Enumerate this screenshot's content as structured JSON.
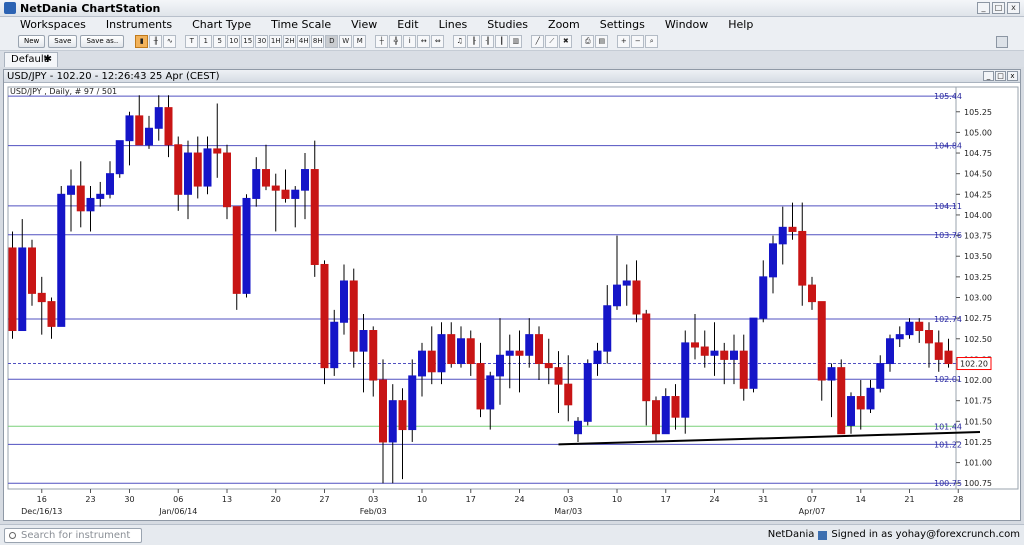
{
  "app": {
    "title": "NetDania ChartStation"
  },
  "window_buttons": [
    "_",
    "□",
    "x"
  ],
  "menu": [
    "Workspaces",
    "Instruments",
    "Chart Type",
    "Time Scale",
    "View",
    "Edit",
    "Lines",
    "Studies",
    "Zoom",
    "Settings",
    "Window",
    "Help"
  ],
  "toolbar": {
    "new_label": "New",
    "save_label": "Save",
    "saveas_label": "Save as..",
    "intervals": [
      "T",
      "1",
      "5",
      "10",
      "15",
      "30",
      "1H",
      "2H",
      "4H",
      "8H",
      "D",
      "W",
      "M"
    ],
    "selected_interval": "D"
  },
  "tab": {
    "label": "Default",
    "close": "✱"
  },
  "chart": {
    "title": "USD/JPY - 102.20 - 12:26:43  25 Apr (CEST)",
    "subtitle": "USD/JPY , Daily, # 97 / 501",
    "colors": {
      "up": "#1515c8",
      "down": "#c81515",
      "grid": "#d0d0d0",
      "hline": "#5050c0",
      "greenline": "#7ad07a",
      "trend": "#000000",
      "price_tag": "#ff0000"
    },
    "current_price": "102.20"
  },
  "chart_data": {
    "type": "candlestick",
    "ylim": [
      100.68,
      105.55
    ],
    "y_ticks": [
      "105.25",
      "105.00",
      "104.75",
      "104.50",
      "104.25",
      "104.00",
      "103.75",
      "103.50",
      "103.25",
      "103.00",
      "102.75",
      "102.50",
      "102.25",
      "102.00",
      "101.75",
      "101.50",
      "101.25",
      "101.00",
      "100.75"
    ],
    "horizontal_lines": [
      {
        "label": "105.44",
        "value": 105.44
      },
      {
        "label": "104.84",
        "value": 104.84
      },
      {
        "label": "104.11",
        "value": 104.11
      },
      {
        "label": "103.76",
        "value": 103.76
      },
      {
        "label": "102.74",
        "value": 102.74
      },
      {
        "label": "102.01",
        "value": 102.01
      },
      {
        "label": "101.44",
        "value": 101.44,
        "color": "green"
      },
      {
        "label": "101.22",
        "value": 101.22
      },
      {
        "label": "100.75",
        "value": 100.75
      }
    ],
    "dashed_price_line": 102.2,
    "trendline": {
      "start": {
        "index": 56,
        "value": 101.22
      },
      "end": {
        "index": 98,
        "value": 101.37
      }
    },
    "x_ticks": [
      {
        "label": "16",
        "index": 3
      },
      {
        "label": "23",
        "index": 8
      },
      {
        "label": "30",
        "index": 12
      },
      {
        "label": "06",
        "index": 17
      },
      {
        "label": "13",
        "index": 22
      },
      {
        "label": "20",
        "index": 27
      },
      {
        "label": "27",
        "index": 32
      },
      {
        "label": "03",
        "index": 37
      },
      {
        "label": "10",
        "index": 42
      },
      {
        "label": "17",
        "index": 47
      },
      {
        "label": "24",
        "index": 52
      },
      {
        "label": "03",
        "index": 57
      },
      {
        "label": "10",
        "index": 62
      },
      {
        "label": "17",
        "index": 67
      },
      {
        "label": "24",
        "index": 72
      },
      {
        "label": "31",
        "index": 77
      },
      {
        "label": "07",
        "index": 82
      },
      {
        "label": "14",
        "index": 87
      },
      {
        "label": "21",
        "index": 92
      },
      {
        "label": "28",
        "index": 97
      }
    ],
    "x_month_labels": [
      {
        "label": "Dec/16/13",
        "index": 3
      },
      {
        "label": "Jan/06/14",
        "index": 17
      },
      {
        "label": "Feb/03",
        "index": 37
      },
      {
        "label": "Mar/03",
        "index": 57
      },
      {
        "label": "Apr/07",
        "index": 82
      }
    ],
    "candles": [
      {
        "o": 103.6,
        "h": 103.8,
        "l": 102.5,
        "c": 102.6
      },
      {
        "o": 102.6,
        "h": 103.95,
        "l": 102.6,
        "c": 103.6
      },
      {
        "o": 103.6,
        "h": 103.7,
        "l": 102.9,
        "c": 103.05
      },
      {
        "o": 103.05,
        "h": 103.25,
        "l": 102.55,
        "c": 102.95
      },
      {
        "o": 102.95,
        "h": 103.0,
        "l": 102.5,
        "c": 102.65
      },
      {
        "o": 102.65,
        "h": 104.35,
        "l": 102.65,
        "c": 104.25
      },
      {
        "o": 104.25,
        "h": 104.55,
        "l": 103.8,
        "c": 104.35
      },
      {
        "o": 104.35,
        "h": 104.65,
        "l": 103.85,
        "c": 104.05
      },
      {
        "o": 104.05,
        "h": 104.35,
        "l": 103.8,
        "c": 104.2
      },
      {
        "o": 104.2,
        "h": 104.4,
        "l": 104.1,
        "c": 104.25
      },
      {
        "o": 104.25,
        "h": 104.65,
        "l": 104.2,
        "c": 104.5
      },
      {
        "o": 104.5,
        "h": 104.9,
        "l": 104.45,
        "c": 104.9
      },
      {
        "o": 104.9,
        "h": 105.25,
        "l": 104.6,
        "c": 105.2
      },
      {
        "o": 105.2,
        "h": 105.45,
        "l": 104.85,
        "c": 104.85
      },
      {
        "o": 104.85,
        "h": 105.2,
        "l": 104.8,
        "c": 105.05
      },
      {
        "o": 105.05,
        "h": 105.45,
        "l": 104.9,
        "c": 105.3
      },
      {
        "o": 105.3,
        "h": 105.45,
        "l": 104.7,
        "c": 104.85
      },
      {
        "o": 104.85,
        "h": 104.95,
        "l": 104.05,
        "c": 104.25
      },
      {
        "o": 104.25,
        "h": 104.9,
        "l": 103.95,
        "c": 104.75
      },
      {
        "o": 104.75,
        "h": 104.95,
        "l": 104.2,
        "c": 104.35
      },
      {
        "o": 104.35,
        "h": 104.95,
        "l": 104.25,
        "c": 104.8
      },
      {
        "o": 104.8,
        "h": 105.35,
        "l": 104.45,
        "c": 104.75
      },
      {
        "o": 104.75,
        "h": 104.85,
        "l": 103.95,
        "c": 104.1
      },
      {
        "o": 104.1,
        "h": 104.1,
        "l": 102.85,
        "c": 103.05
      },
      {
        "o": 103.05,
        "h": 104.25,
        "l": 103.0,
        "c": 104.2
      },
      {
        "o": 104.2,
        "h": 104.7,
        "l": 104.1,
        "c": 104.55
      },
      {
        "o": 104.55,
        "h": 104.85,
        "l": 104.3,
        "c": 104.35
      },
      {
        "o": 104.35,
        "h": 104.5,
        "l": 103.8,
        "c": 104.3
      },
      {
        "o": 104.3,
        "h": 104.55,
        "l": 104.15,
        "c": 104.2
      },
      {
        "o": 104.2,
        "h": 104.35,
        "l": 103.85,
        "c": 104.3
      },
      {
        "o": 104.3,
        "h": 104.75,
        "l": 103.95,
        "c": 104.55
      },
      {
        "o": 104.55,
        "h": 104.9,
        "l": 103.25,
        "c": 103.4
      },
      {
        "o": 103.4,
        "h": 103.45,
        "l": 101.95,
        "c": 102.15
      },
      {
        "o": 102.15,
        "h": 102.85,
        "l": 102.05,
        "c": 102.7
      },
      {
        "o": 102.7,
        "h": 103.4,
        "l": 102.55,
        "c": 103.2
      },
      {
        "o": 103.2,
        "h": 103.35,
        "l": 102.15,
        "c": 102.35
      },
      {
        "o": 102.35,
        "h": 102.8,
        "l": 101.85,
        "c": 102.6
      },
      {
        "o": 102.6,
        "h": 102.65,
        "l": 101.8,
        "c": 102.0
      },
      {
        "o": 102.0,
        "h": 102.25,
        "l": 100.75,
        "c": 101.25
      },
      {
        "o": 101.25,
        "h": 101.95,
        "l": 100.75,
        "c": 101.75
      },
      {
        "o": 101.75,
        "h": 101.9,
        "l": 100.8,
        "c": 101.4
      },
      {
        "o": 101.4,
        "h": 102.25,
        "l": 101.25,
        "c": 102.05
      },
      {
        "o": 102.05,
        "h": 102.45,
        "l": 101.8,
        "c": 102.35
      },
      {
        "o": 102.35,
        "h": 102.65,
        "l": 101.95,
        "c": 102.1
      },
      {
        "o": 102.1,
        "h": 102.7,
        "l": 101.95,
        "c": 102.55
      },
      {
        "o": 102.55,
        "h": 102.7,
        "l": 102.15,
        "c": 102.2
      },
      {
        "o": 102.2,
        "h": 102.65,
        "l": 102.15,
        "c": 102.5
      },
      {
        "o": 102.5,
        "h": 102.6,
        "l": 102.05,
        "c": 102.2
      },
      {
        "o": 102.2,
        "h": 102.45,
        "l": 101.55,
        "c": 101.65
      },
      {
        "o": 101.65,
        "h": 102.1,
        "l": 101.4,
        "c": 102.05
      },
      {
        "o": 102.05,
        "h": 102.75,
        "l": 101.7,
        "c": 102.3
      },
      {
        "o": 102.3,
        "h": 102.55,
        "l": 101.9,
        "c": 102.35
      },
      {
        "o": 102.35,
        "h": 102.6,
        "l": 101.85,
        "c": 102.3
      },
      {
        "o": 102.3,
        "h": 102.75,
        "l": 102.15,
        "c": 102.55
      },
      {
        "o": 102.55,
        "h": 102.65,
        "l": 102.0,
        "c": 102.2
      },
      {
        "o": 102.2,
        "h": 102.5,
        "l": 101.95,
        "c": 102.15
      },
      {
        "o": 102.15,
        "h": 102.35,
        "l": 101.6,
        "c": 101.95
      },
      {
        "o": 101.95,
        "h": 102.3,
        "l": 101.5,
        "c": 101.7
      },
      {
        "o": 101.35,
        "h": 101.55,
        "l": 101.25,
        "c": 101.5
      },
      {
        "o": 101.5,
        "h": 102.25,
        "l": 101.45,
        "c": 102.2
      },
      {
        "o": 102.2,
        "h": 102.45,
        "l": 102.05,
        "c": 102.35
      },
      {
        "o": 102.35,
        "h": 103.15,
        "l": 102.2,
        "c": 102.9
      },
      {
        "o": 102.9,
        "h": 103.75,
        "l": 102.85,
        "c": 103.15
      },
      {
        "o": 103.15,
        "h": 103.4,
        "l": 102.9,
        "c": 103.2
      },
      {
        "o": 103.2,
        "h": 103.45,
        "l": 102.7,
        "c": 102.8
      },
      {
        "o": 102.8,
        "h": 102.85,
        "l": 101.45,
        "c": 101.75
      },
      {
        "o": 101.75,
        "h": 101.8,
        "l": 101.25,
        "c": 101.35
      },
      {
        "o": 101.35,
        "h": 101.9,
        "l": 101.35,
        "c": 101.8
      },
      {
        "o": 101.8,
        "h": 101.95,
        "l": 101.4,
        "c": 101.55
      },
      {
        "o": 101.55,
        "h": 102.6,
        "l": 101.35,
        "c": 102.45
      },
      {
        "o": 102.45,
        "h": 102.8,
        "l": 102.25,
        "c": 102.4
      },
      {
        "o": 102.4,
        "h": 102.6,
        "l": 102.15,
        "c": 102.3
      },
      {
        "o": 102.3,
        "h": 102.7,
        "l": 102.05,
        "c": 102.35
      },
      {
        "o": 102.35,
        "h": 102.45,
        "l": 101.95,
        "c": 102.25
      },
      {
        "o": 102.25,
        "h": 102.55,
        "l": 101.95,
        "c": 102.35
      },
      {
        "o": 102.35,
        "h": 102.55,
        "l": 101.75,
        "c": 101.9
      },
      {
        "o": 101.9,
        "h": 102.75,
        "l": 101.85,
        "c": 102.75
      },
      {
        "o": 102.75,
        "h": 103.45,
        "l": 102.7,
        "c": 103.25
      },
      {
        "o": 103.25,
        "h": 103.75,
        "l": 103.05,
        "c": 103.65
      },
      {
        "o": 103.65,
        "h": 104.1,
        "l": 103.4,
        "c": 103.85
      },
      {
        "o": 103.85,
        "h": 104.15,
        "l": 103.7,
        "c": 103.8
      },
      {
        "o": 103.8,
        "h": 104.15,
        "l": 102.9,
        "c": 103.15
      },
      {
        "o": 103.15,
        "h": 103.25,
        "l": 102.85,
        "c": 102.95
      },
      {
        "o": 102.95,
        "h": 102.95,
        "l": 101.75,
        "c": 102.0
      },
      {
        "o": 102.0,
        "h": 102.2,
        "l": 101.55,
        "c": 102.15
      },
      {
        "o": 102.15,
        "h": 102.25,
        "l": 101.35,
        "c": 101.35
      },
      {
        "o": 101.45,
        "h": 101.85,
        "l": 101.35,
        "c": 101.8
      },
      {
        "o": 101.8,
        "h": 102.0,
        "l": 101.4,
        "c": 101.65
      },
      {
        "o": 101.65,
        "h": 102.0,
        "l": 101.6,
        "c": 101.9
      },
      {
        "o": 101.9,
        "h": 102.3,
        "l": 101.85,
        "c": 102.2
      },
      {
        "o": 102.2,
        "h": 102.55,
        "l": 102.1,
        "c": 102.5
      },
      {
        "o": 102.5,
        "h": 102.65,
        "l": 102.4,
        "c": 102.55
      },
      {
        "o": 102.55,
        "h": 102.75,
        "l": 102.5,
        "c": 102.7
      },
      {
        "o": 102.7,
        "h": 102.75,
        "l": 102.45,
        "c": 102.6
      },
      {
        "o": 102.6,
        "h": 102.7,
        "l": 102.15,
        "c": 102.45
      },
      {
        "o": 102.45,
        "h": 102.6,
        "l": 102.1,
        "c": 102.25
      },
      {
        "o": 102.35,
        "h": 102.5,
        "l": 102.15,
        "c": 102.2
      }
    ]
  },
  "status": {
    "search_placeholder": "Search for instrument",
    "brand": "NetDania",
    "signed_in": "Signed in as yohay@forexcrunch.com"
  }
}
